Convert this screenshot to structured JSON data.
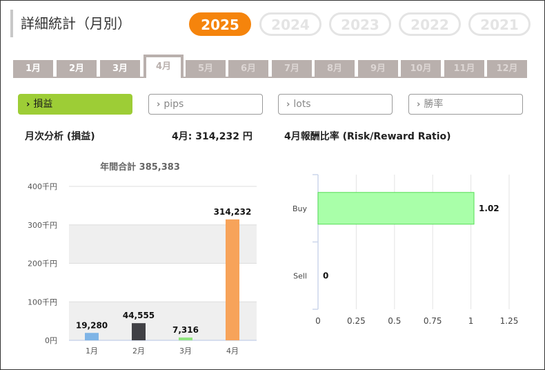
{
  "page": {
    "title": "詳細統計（月別）"
  },
  "years": [
    {
      "label": "2025",
      "active": true
    },
    {
      "label": "2024",
      "active": false
    },
    {
      "label": "2023",
      "active": false
    },
    {
      "label": "2022",
      "active": false
    },
    {
      "label": "2021",
      "active": false
    }
  ],
  "months": [
    {
      "label": "1月",
      "state": "enabled"
    },
    {
      "label": "2月",
      "state": "enabled"
    },
    {
      "label": "3月",
      "state": "enabled"
    },
    {
      "label": "4月",
      "state": "active"
    },
    {
      "label": "5月",
      "state": "disabled"
    },
    {
      "label": "6月",
      "state": "disabled"
    },
    {
      "label": "7月",
      "state": "disabled"
    },
    {
      "label": "8月",
      "state": "disabled"
    },
    {
      "label": "9月",
      "state": "disabled"
    },
    {
      "label": "10月",
      "state": "disabled"
    },
    {
      "label": "11月",
      "state": "disabled"
    },
    {
      "label": "12月",
      "state": "disabled"
    }
  ],
  "metric_tabs": [
    {
      "label": "損益",
      "active": true
    },
    {
      "label": "pips",
      "active": false
    },
    {
      "label": "lots",
      "active": false
    },
    {
      "label": "勝率",
      "active": false
    }
  ],
  "monthly_analysis": {
    "heading": "月次分析 (損益)",
    "current_month_summary": "4月:  314,232 円"
  },
  "ratio_section": {
    "heading": "4月報酬比率 (Risk/Reward Ratio)"
  },
  "colors": {
    "accent": "#f5840c",
    "tab_active": "#9dcd36",
    "tab_bg": "#b9b0ad",
    "bar_jan": "#7eb4e6",
    "bar_feb": "#404045",
    "bar_mar": "#90e47e",
    "bar_apr": "#f7a35a",
    "bar_ratio": "#a9ffa9",
    "bar_ratio_border": "#55dd55"
  },
  "chart_data": [
    {
      "type": "bar",
      "title": "年間合計 385,383",
      "categories": [
        "1月",
        "2月",
        "3月",
        "4月"
      ],
      "values": [
        19280,
        44555,
        7316,
        314232
      ],
      "value_labels": [
        "19,280",
        "44,555",
        "7,316",
        "314,232"
      ],
      "ylim": [
        0,
        400000
      ],
      "yticks": [
        0,
        100000,
        200000,
        300000,
        400000
      ],
      "ytick_labels": [
        "0円",
        "100千円",
        "200千円",
        "300千円",
        "400千円"
      ],
      "bar_colors": [
        "#7eb4e6",
        "#404045",
        "#90e47e",
        "#f7a35a"
      ],
      "grid": "alternating bands",
      "legend": "none"
    },
    {
      "type": "bar",
      "orientation": "horizontal",
      "categories": [
        "Buy",
        "Sell"
      ],
      "values": [
        1.02,
        0
      ],
      "value_labels": [
        "1.02",
        "0"
      ],
      "xlim": [
        0,
        1.25
      ],
      "xticks": [
        0,
        0.25,
        0.5,
        0.75,
        1,
        1.25
      ],
      "xtick_labels": [
        "0",
        "0.25",
        "0.5",
        "0.75",
        "1",
        "1.25"
      ],
      "grid": true,
      "legend": "none"
    }
  ]
}
